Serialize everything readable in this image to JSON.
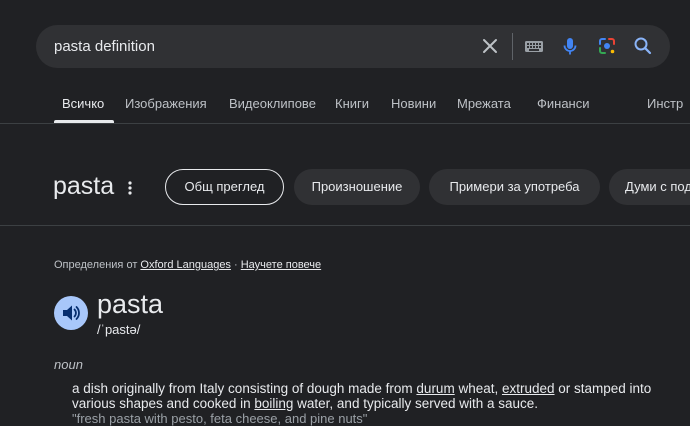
{
  "search": {
    "query": "pasta definition",
    "icons": [
      "close-icon",
      "keyboard-icon",
      "mic-icon",
      "lens-icon",
      "search-icon"
    ],
    "colors": {
      "mic": "#4285f4",
      "search": "#8ab4f8"
    }
  },
  "tabs": [
    {
      "label": "Всичко",
      "active": true
    },
    {
      "label": "Изображения"
    },
    {
      "label": "Видеоклипове"
    },
    {
      "label": "Книги"
    },
    {
      "label": "Новини"
    },
    {
      "label": "Мрежата"
    },
    {
      "label": "Финанси"
    },
    {
      "label": "Инстр"
    }
  ],
  "word_header": {
    "title": "pasta",
    "chips": [
      {
        "label": "Общ преглед",
        "selected": true
      },
      {
        "label": "Произношение"
      },
      {
        "label": "Примери за употреба"
      },
      {
        "label": "Думи с под"
      }
    ]
  },
  "definition": {
    "source_prefix": "Определения от",
    "source_name": "Oxford Languages",
    "source_sep": "·",
    "learn_more": "Научете повече",
    "word": "pasta",
    "phonetic": "/ˈpastə/",
    "part_of_speech": "noun",
    "def_parts": {
      "p1": "a dish originally from Italy consisting of dough made from ",
      "link1": "durum",
      "p2": " wheat, ",
      "link2": "extruded",
      "p3": " or stamped into various shapes and cooked in ",
      "link3": "boiling",
      "p4": " water, and typically served with a sauce."
    },
    "example": "\"fresh pasta with pesto, feta cheese, and pine nuts\""
  }
}
